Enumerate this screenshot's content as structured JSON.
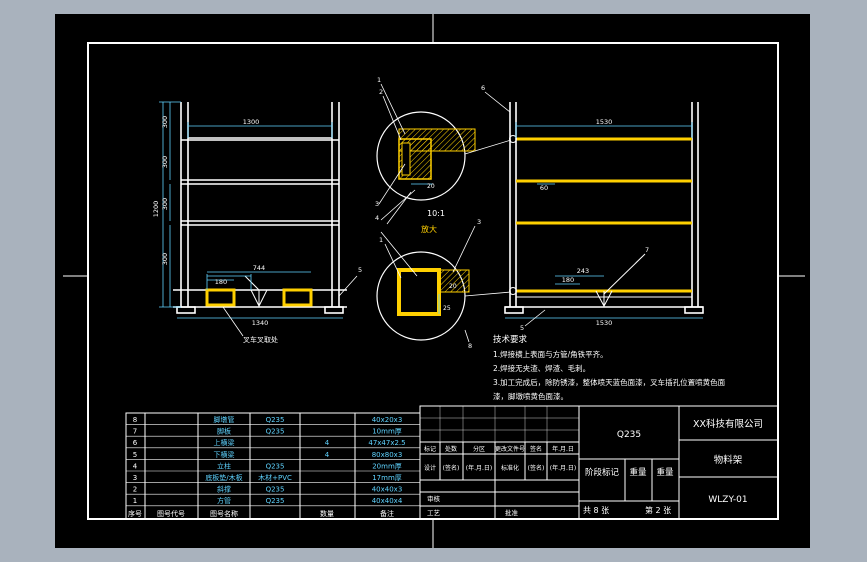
{
  "front_view": {
    "top_width": "1300",
    "base_width": "1340",
    "base_dim": "744",
    "foot_dim": "180",
    "height_dims": [
      "300",
      "300",
      "300",
      "300"
    ],
    "total_height": "1200",
    "caption": "叉车叉取处"
  },
  "side_view": {
    "top_width": "1530",
    "base_width": "1530",
    "base_dim": "243",
    "foot_dim": "180",
    "mid_dim": "60"
  },
  "detail": {
    "scale": "10:1",
    "title": "放大",
    "dim_a": "20",
    "dim_b": "25",
    "dim_c": "20"
  },
  "balloons": [
    "1",
    "2",
    "3",
    "4",
    "5",
    "6",
    "7",
    "8"
  ],
  "tech": {
    "title": "技术要求",
    "items": [
      "1.焊接横上表面与方管/角铁平齐。",
      "2.焊接无夹渣、焊渣、毛刺。",
      "3.加工完成后，除防锈漆，整体喷天蓝色面漆，叉车插孔位置喷黄色面",
      "漆，脚墩喷黄色面漆。"
    ]
  },
  "bom": {
    "rows": [
      {
        "no": "8",
        "name": "脚墩管",
        "mat": "Q235",
        "qty": "",
        "spec": "40x20x3"
      },
      {
        "no": "7",
        "name": "脚板",
        "mat": "Q235",
        "qty": "",
        "spec": "10mm厚"
      },
      {
        "no": "6",
        "name": "上横梁",
        "mat": "",
        "qty": "4",
        "spec": "47x47x2.5"
      },
      {
        "no": "5",
        "name": "下横梁",
        "mat": "",
        "qty": "4",
        "spec": "80x80x3"
      },
      {
        "no": "4",
        "name": "立柱",
        "mat": "Q235",
        "qty": "",
        "spec": "20mm厚"
      },
      {
        "no": "3",
        "name": "底板垫/木板",
        "mat": "木材+PVC",
        "qty": "",
        "spec": "17mm厚"
      },
      {
        "no": "2",
        "name": "斜撑",
        "mat": "Q235",
        "qty": "",
        "spec": "40x40x3"
      },
      {
        "no": "1",
        "name": "方管",
        "mat": "Q235",
        "qty": "",
        "spec": "40x40x4"
      }
    ],
    "header": {
      "no": "序号",
      "name": "图号代号",
      "name2": "图号名称",
      "qty": "数量",
      "spec": "备注"
    }
  },
  "title_block": {
    "material": "Q235",
    "company": "XX科技有限公司",
    "part_name": "物料架",
    "drawing_no": "WLZY-01",
    "stage_label": "阶段标记",
    "weight_label": "重量",
    "ratio_label": "重量",
    "sheets_total": "共 8 张",
    "sheet_no": "第 2 张",
    "rev_headers": [
      "标记",
      "处数",
      "分区",
      "更改文件号",
      "签名",
      "年.月.日"
    ],
    "sign_headers": [
      "设计",
      "(签名)",
      "(年.月.日)",
      "标准化",
      "(签名)",
      "(年.月.日)"
    ],
    "audit": "审核",
    "process": "工艺",
    "approve": "批准"
  }
}
